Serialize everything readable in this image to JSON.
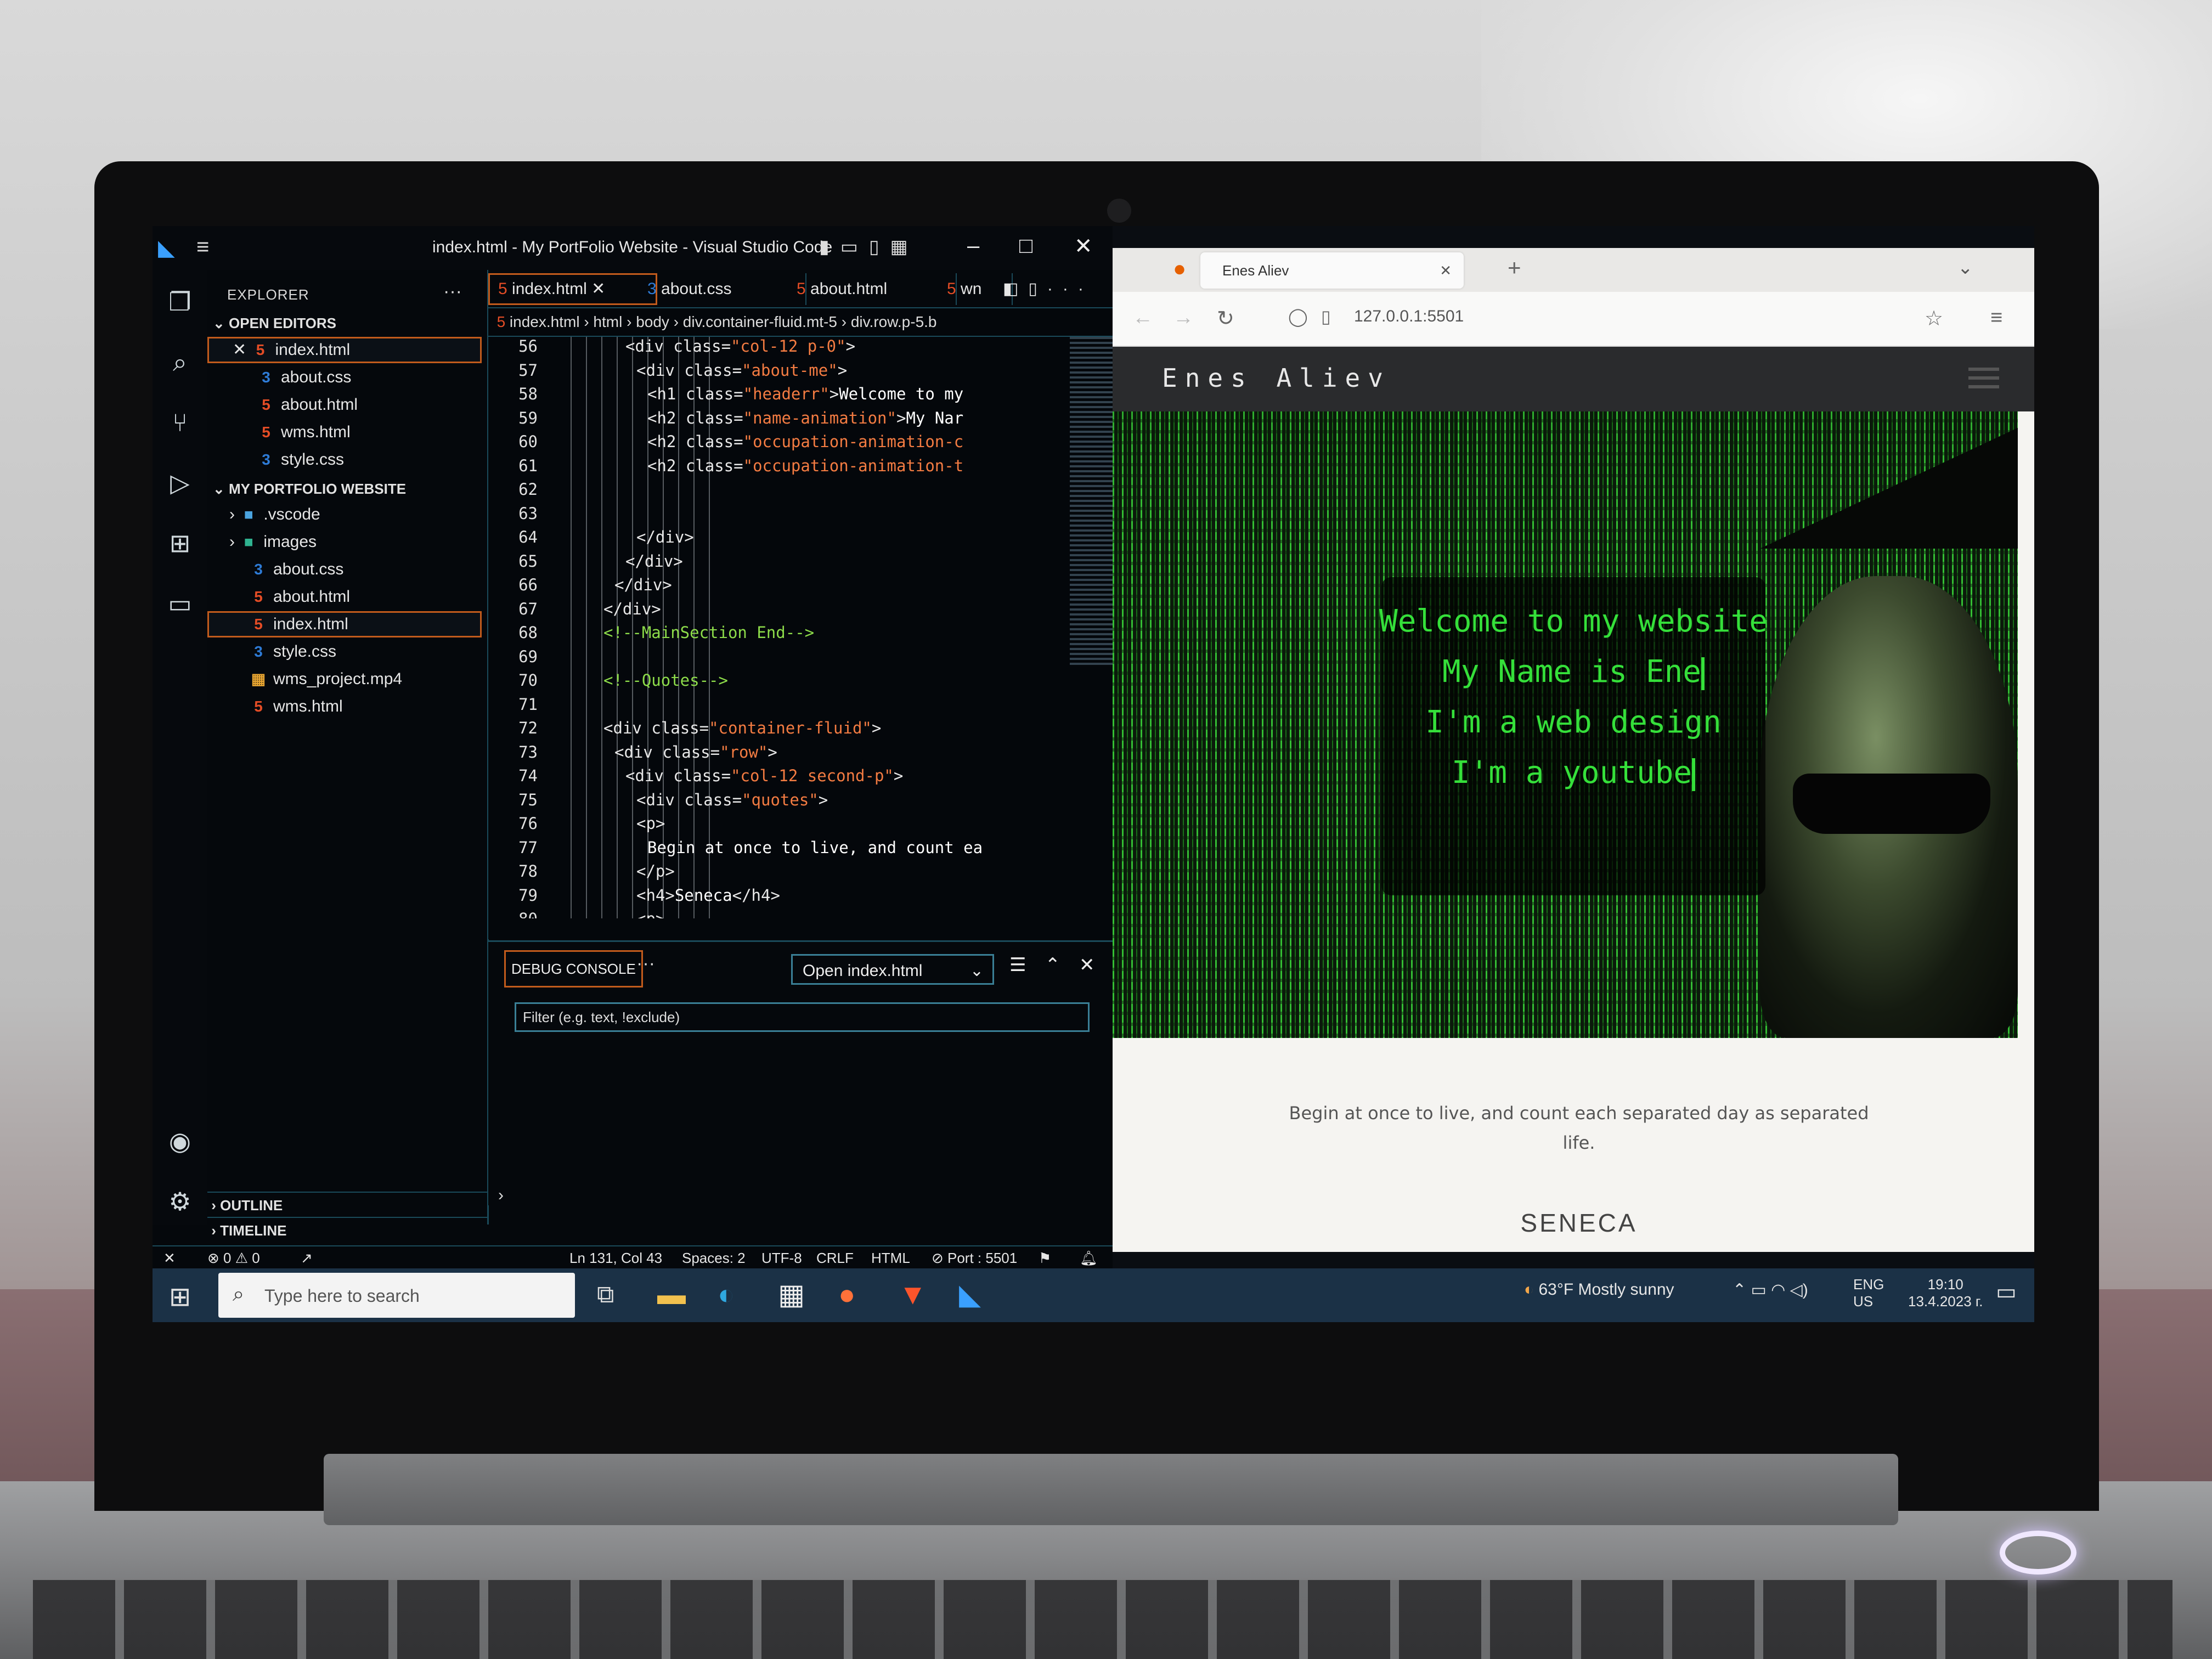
{
  "vscode": {
    "window_title": "index.html - My PortFolio Website - Visual Studio Code",
    "explorer_label": "EXPLORER",
    "open_editors_label": "OPEN EDITORS",
    "open_editors": [
      "index.html",
      "about.css",
      "about.html",
      "wms.html",
      "style.css"
    ],
    "project_label": "MY PORTFOLIO WEBSITE",
    "project_items": [
      {
        "name": ".vscode",
        "type": "folder"
      },
      {
        "name": "images",
        "type": "folder"
      },
      {
        "name": "about.css",
        "type": "css"
      },
      {
        "name": "about.html",
        "type": "html"
      },
      {
        "name": "index.html",
        "type": "html",
        "selected": true
      },
      {
        "name": "style.css",
        "type": "css"
      },
      {
        "name": "wms_project.mp4",
        "type": "video"
      },
      {
        "name": "wms.html",
        "type": "html"
      }
    ],
    "outline_label": "OUTLINE",
    "timeline_label": "TIMELINE",
    "tabs": [
      "index.html",
      "about.css",
      "about.html",
      "wn"
    ],
    "breadcrumb": "index.html › html › body › div.container-fluid.mt-5 › div.row.p-5.b",
    "code_lines": [
      {
        "n": "56",
        "indent": 5,
        "parts": [
          [
            "tg",
            "<div "
          ],
          [
            "at",
            "class="
          ],
          [
            "st",
            "\"col-12 p-0\""
          ],
          [
            "tg",
            ">"
          ]
        ]
      },
      {
        "n": "57",
        "indent": 6,
        "parts": [
          [
            "tg",
            "<div "
          ],
          [
            "at",
            "class="
          ],
          [
            "st",
            "\"about-me\""
          ],
          [
            "tg",
            ">"
          ]
        ]
      },
      {
        "n": "58",
        "indent": 7,
        "parts": [
          [
            "tg",
            "<h1 "
          ],
          [
            "at",
            "class="
          ],
          [
            "st",
            "\"headerr\""
          ],
          [
            "tg",
            ">"
          ],
          [
            "tx",
            "Welcome to my"
          ]
        ]
      },
      {
        "n": "59",
        "indent": 7,
        "parts": [
          [
            "tg",
            "<h2 "
          ],
          [
            "at",
            "class="
          ],
          [
            "st",
            "\"name-animation\""
          ],
          [
            "tg",
            ">"
          ],
          [
            "tx",
            "My Nar"
          ]
        ]
      },
      {
        "n": "60",
        "indent": 7,
        "parts": [
          [
            "tg",
            "<h2 "
          ],
          [
            "at",
            "class="
          ],
          [
            "st",
            "\"occupation-animation-c"
          ]
        ]
      },
      {
        "n": "61",
        "indent": 7,
        "parts": [
          [
            "tg",
            "<h2 "
          ],
          [
            "at",
            "class="
          ],
          [
            "st",
            "\"occupation-animation-t"
          ]
        ]
      },
      {
        "n": "62",
        "indent": 0,
        "parts": []
      },
      {
        "n": "63",
        "indent": 0,
        "parts": []
      },
      {
        "n": "64",
        "indent": 6,
        "parts": [
          [
            "tg",
            "</div>"
          ]
        ]
      },
      {
        "n": "65",
        "indent": 5,
        "parts": [
          [
            "tg",
            "</div>"
          ]
        ]
      },
      {
        "n": "66",
        "indent": 4,
        "parts": [
          [
            "tg",
            "</div>"
          ]
        ]
      },
      {
        "n": "67",
        "indent": 3,
        "parts": [
          [
            "tg",
            "</div>"
          ]
        ]
      },
      {
        "n": "68",
        "indent": 3,
        "parts": [
          [
            "cm",
            "<!--MainSection End-->"
          ]
        ]
      },
      {
        "n": "69",
        "indent": 0,
        "parts": []
      },
      {
        "n": "70",
        "indent": 3,
        "parts": [
          [
            "cm",
            "<!--Quotes-->"
          ]
        ]
      },
      {
        "n": "71",
        "indent": 0,
        "parts": []
      },
      {
        "n": "72",
        "indent": 3,
        "parts": [
          [
            "tg",
            "<div "
          ],
          [
            "at",
            "class="
          ],
          [
            "st",
            "\"container-fluid\""
          ],
          [
            "tg",
            ">"
          ]
        ]
      },
      {
        "n": "73",
        "indent": 4,
        "parts": [
          [
            "tg",
            "<div "
          ],
          [
            "at",
            "class="
          ],
          [
            "st",
            "\"row\""
          ],
          [
            "tg",
            ">"
          ]
        ]
      },
      {
        "n": "74",
        "indent": 5,
        "parts": [
          [
            "tg",
            "<div "
          ],
          [
            "at",
            "class="
          ],
          [
            "st",
            "\"col-12 second-p\""
          ],
          [
            "tg",
            ">"
          ]
        ]
      },
      {
        "n": "75",
        "indent": 6,
        "parts": [
          [
            "tg",
            "<div "
          ],
          [
            "at",
            "class="
          ],
          [
            "st",
            "\"quotes\""
          ],
          [
            "tg",
            ">"
          ]
        ]
      },
      {
        "n": "76",
        "indent": 6,
        "parts": [
          [
            "tg",
            "<p>"
          ]
        ]
      },
      {
        "n": "77",
        "indent": 7,
        "parts": [
          [
            "tx",
            "Begin at once to live, and count ea"
          ]
        ]
      },
      {
        "n": "78",
        "indent": 6,
        "parts": [
          [
            "tg",
            "</p>"
          ]
        ]
      },
      {
        "n": "79",
        "indent": 6,
        "parts": [
          [
            "tg",
            "<h4>"
          ],
          [
            "tx",
            "Seneca"
          ],
          [
            "tg",
            "</h4>"
          ]
        ]
      },
      {
        "n": "80",
        "indent": 6,
        "parts": [
          [
            "tg",
            "<p>"
          ]
        ]
      }
    ],
    "panel_tab": "DEBUG CONSOLE",
    "panel_select": "Open index.html",
    "filter_placeholder": "Filter (e.g. text, !exclude)",
    "status": {
      "problems": "⊗ 0 ⚠ 0",
      "position": "Ln 131, Col 43",
      "spaces": "Spaces: 2",
      "encoding": "UTF-8",
      "eol": "CRLF",
      "language": "HTML",
      "port": "⊘ Port : 5501"
    }
  },
  "firefox": {
    "tab_title": "Enes Aliev",
    "url": "127.0.0.1:5501",
    "site": {
      "brand": "Enes Aliev",
      "hero_lines": [
        "Welcome to my website",
        "My Name is Ene",
        "I'm a web design",
        "I'm a youtube"
      ],
      "quote": "Begin at once to live, and count each separated day as separated life.",
      "author": "SENECA"
    }
  },
  "taskbar": {
    "search_placeholder": "Type here to search",
    "weather": "63°F  Mostly sunny",
    "lang": "ENG",
    "region": "US",
    "time": "19:10",
    "date": "13.4.2023 г."
  },
  "colors": {
    "accent_border": "#c25b1c",
    "matrix_green": "#35e03a",
    "taskbar": "#1b3146"
  }
}
